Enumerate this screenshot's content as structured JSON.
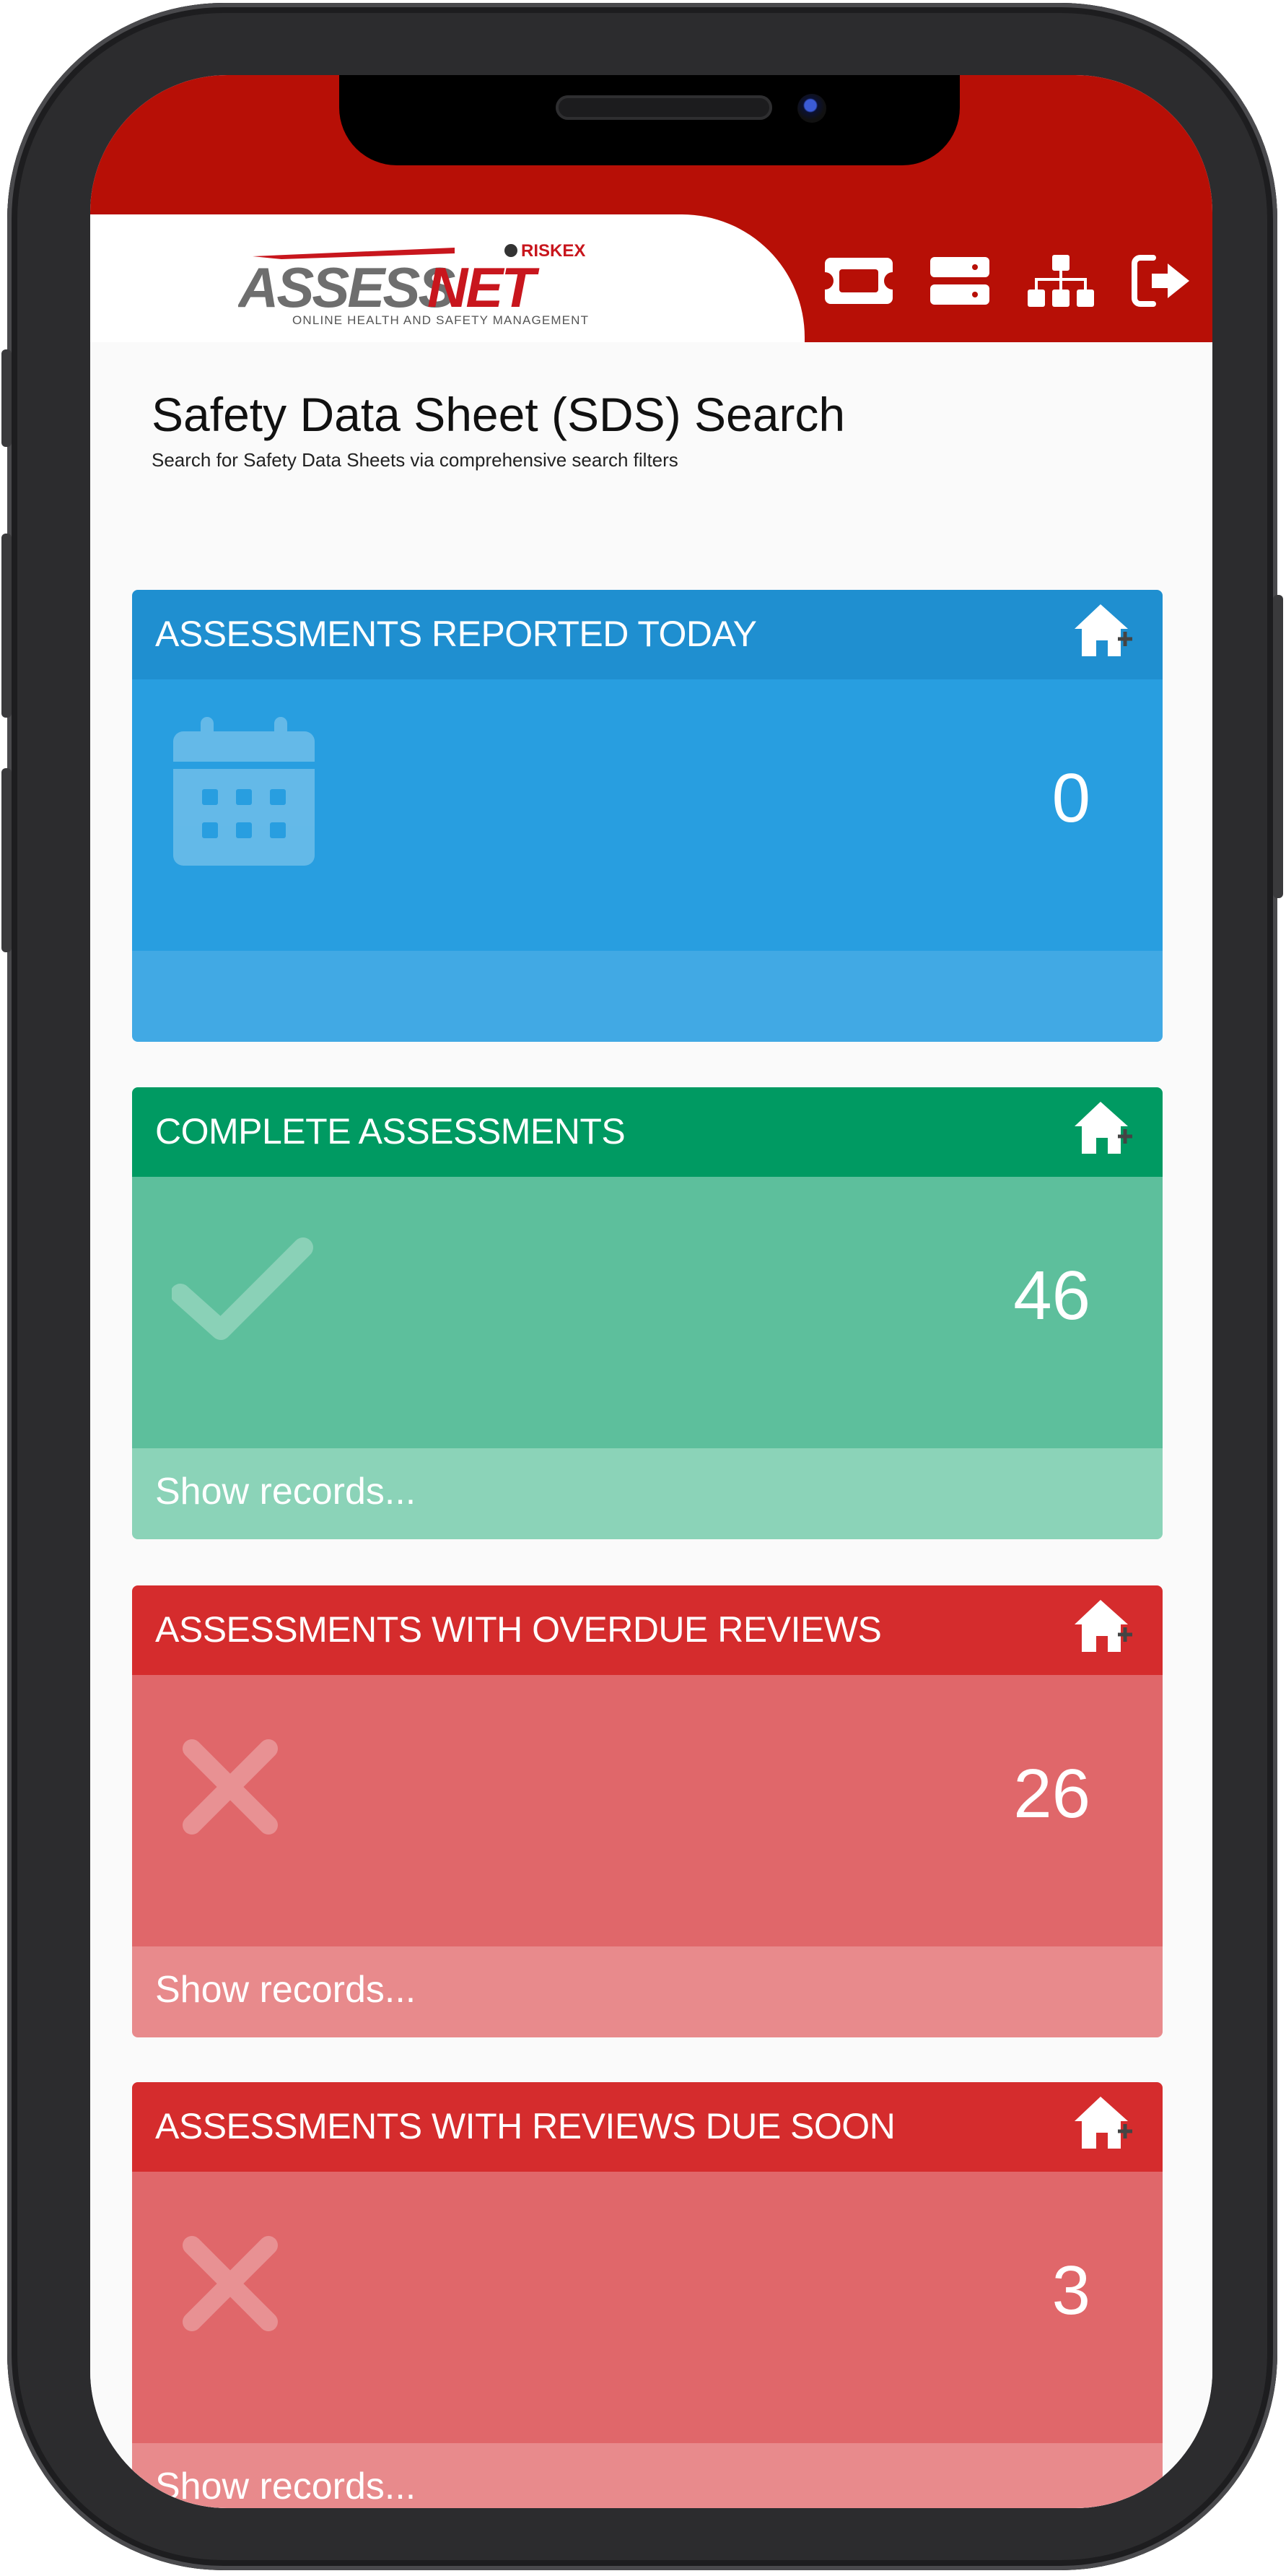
{
  "brand": {
    "logo_top": "RISKEX",
    "logo_main_left": "ASSESS",
    "logo_main_right": "NET",
    "logo_tagline": "ONLINE HEALTH AND SAFETY MANAGEMENT",
    "primary_color": "#b70f06"
  },
  "nav": {
    "icons": [
      "ticket-icon",
      "server-icon",
      "sitemap-icon",
      "sign-out-icon"
    ]
  },
  "page": {
    "title": "Safety Data Sheet (SDS) Search",
    "subtitle": "Search for Safety Data Sheets via comprehensive search filters"
  },
  "cards": [
    {
      "title": "ASSESSMENTS REPORTED TODAY",
      "value": "0",
      "icon": "calendar-icon",
      "footer": "",
      "color": "#289ee0"
    },
    {
      "title": "COMPLETE ASSESSMENTS",
      "value": "46",
      "icon": "check-icon",
      "footer": "Show records...",
      "color": "#5dbf9c"
    },
    {
      "title": "ASSESSMENTS WITH OVERDUE REVIEWS",
      "value": "26",
      "icon": "cross-icon",
      "footer": "Show records...",
      "color": "#e0676a"
    },
    {
      "title": "ASSESSMENTS WITH REVIEWS DUE SOON",
      "value": "3",
      "icon": "cross-icon",
      "footer": "Show records...",
      "color": "#e0676a"
    }
  ]
}
